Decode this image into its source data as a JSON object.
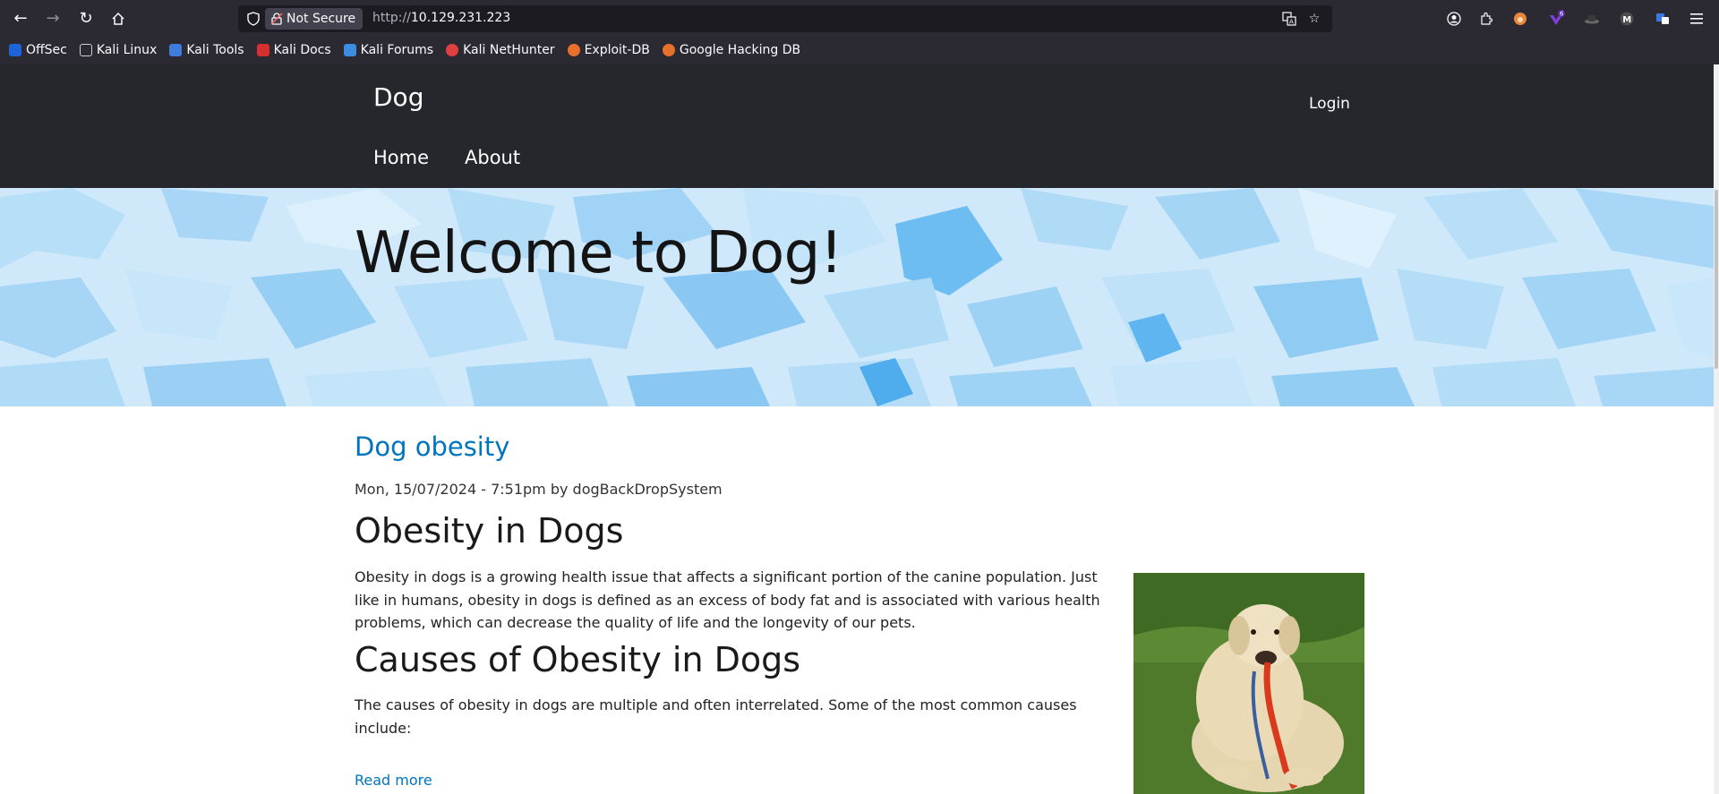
{
  "browser": {
    "url_protocol": "http://",
    "url_host": "10.129.231.223",
    "security_label": "Not Secure",
    "extension_badge": "6",
    "bookmarks": [
      {
        "label": "OffSec",
        "color": "#1e64d8"
      },
      {
        "label": "Kali Linux",
        "color": "#cfcfcf"
      },
      {
        "label": "Kali Tools",
        "color": "#3e7ddb"
      },
      {
        "label": "Kali Docs",
        "color": "#d62f2f"
      },
      {
        "label": "Kali Forums",
        "color": "#3a8de0"
      },
      {
        "label": "Kali NetHunter",
        "color": "#e04040"
      },
      {
        "label": "Exploit-DB",
        "color": "#e8702a"
      },
      {
        "label": "Google Hacking DB",
        "color": "#e8702a"
      }
    ]
  },
  "site": {
    "name": "Dog",
    "login_label": "Login",
    "nav": [
      "Home",
      "About"
    ]
  },
  "hero": {
    "title": "Welcome to Dog!"
  },
  "article": {
    "title": "Dog obesity",
    "meta": "Mon, 15/07/2024 - 7:51pm by dogBackDropSystem",
    "heading1": "Obesity in Dogs",
    "paragraph1": "Obesity in dogs is a growing health issue that affects a significant portion of the canine population. Just like in humans, obesity in dogs is defined as an excess of body fat and is associated with various health problems, which can decrease the quality of life and the longevity of our pets.",
    "heading2": "Causes of Obesity in Dogs",
    "paragraph2": "The causes of obesity in dogs are multiple and often interrelated. Some of the most common causes include:",
    "read_more": "Read more"
  },
  "colors": {
    "chrome_bg": "#2b2a33",
    "site_header_bg": "#25272c",
    "link": "#0074bd",
    "hero_bg": "#cfe9fb"
  }
}
